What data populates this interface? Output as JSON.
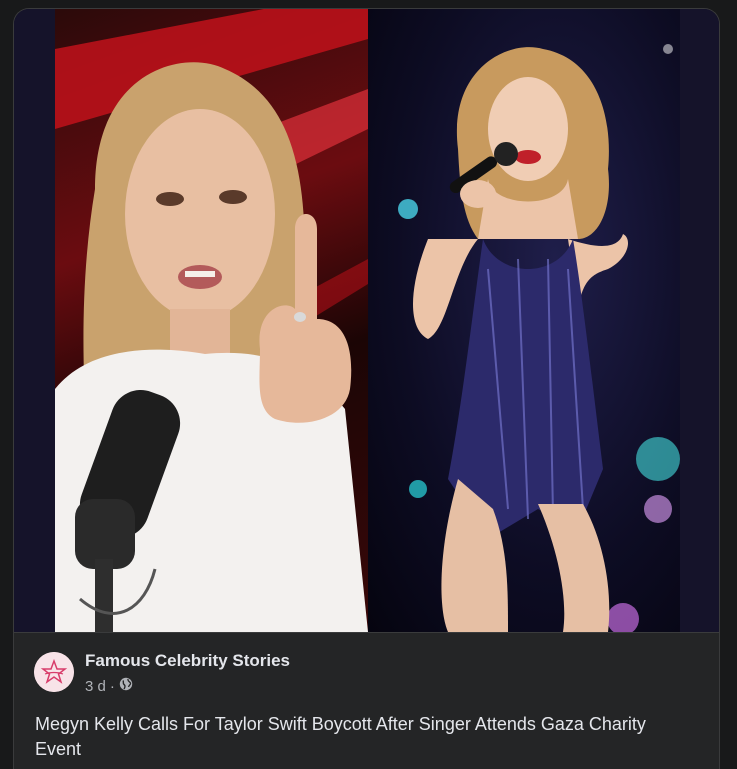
{
  "post": {
    "page_name": "Famous Celebrity Stories",
    "time": "3 d",
    "separator": "·",
    "audience_icon": "globe-icon",
    "caption": "Megyn Kelly Calls For Taylor Swift Boycott After Singer Attends Gaza Charity Event",
    "media": {
      "left_photo": "woman-pointing-at-microphone",
      "right_photo": "singer-on-stage-with-microphone"
    },
    "avatar_logo": "famous-celebrity-stories-logo"
  },
  "colors": {
    "background": "#18191a",
    "card": "#242526",
    "primary_text": "#e4e6eb",
    "secondary_text": "#b0b3b8"
  }
}
